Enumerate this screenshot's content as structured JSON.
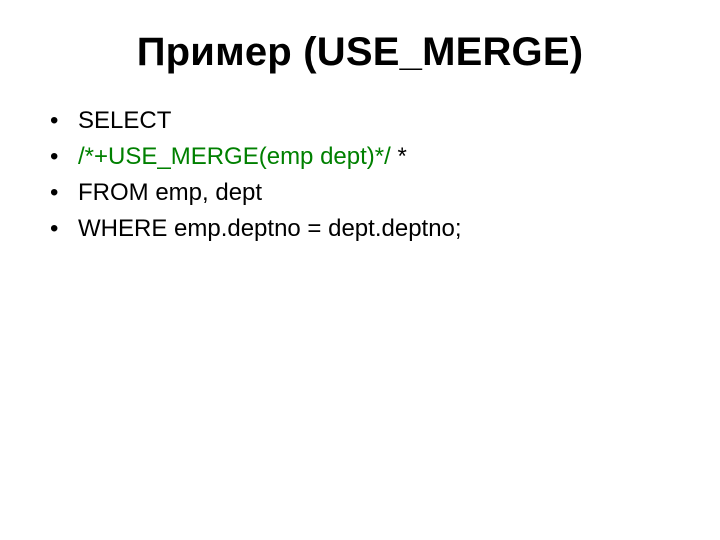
{
  "title": "Пример (USE_MERGE)",
  "lines": {
    "l1": "SELECT",
    "l2_hint": "/*+USE_MERGE(emp dept)*/",
    "l2_trail": " *",
    "l3": "FROM emp, dept",
    "l4": "WHERE emp.deptno = dept.deptno;"
  }
}
